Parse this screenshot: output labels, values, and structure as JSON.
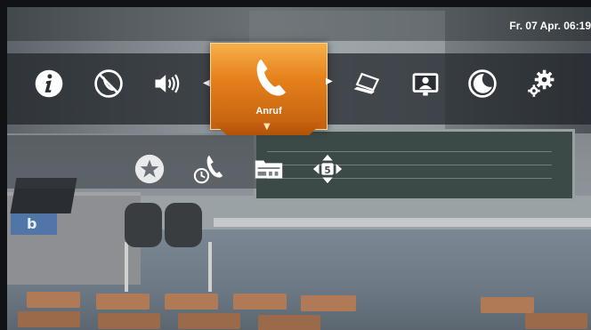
{
  "status": {
    "datetime": "Fr. 07 Apr. 06:19"
  },
  "menu": {
    "selected_label": "Anruf",
    "items": [
      {
        "name": "info-icon"
      },
      {
        "name": "mute-call-icon"
      },
      {
        "name": "speaker-volume-icon"
      },
      {
        "name": "phone-icon",
        "label": "Anruf",
        "selected": true
      },
      {
        "name": "laptop-share-icon"
      },
      {
        "name": "camera-presenter-icon"
      },
      {
        "name": "moon-icon"
      },
      {
        "name": "settings-gears-icon"
      }
    ]
  },
  "submenu": {
    "items": [
      {
        "name": "favorites-star-icon"
      },
      {
        "name": "call-history-icon"
      },
      {
        "name": "phonebook-directory-icon"
      },
      {
        "name": "keypad-direction-icon",
        "value": "5"
      }
    ]
  },
  "colors": {
    "accent": "#e6821b",
    "accent_light": "#f7b04a",
    "accent_dark": "#c45f0f",
    "icon": "#ffffff"
  }
}
